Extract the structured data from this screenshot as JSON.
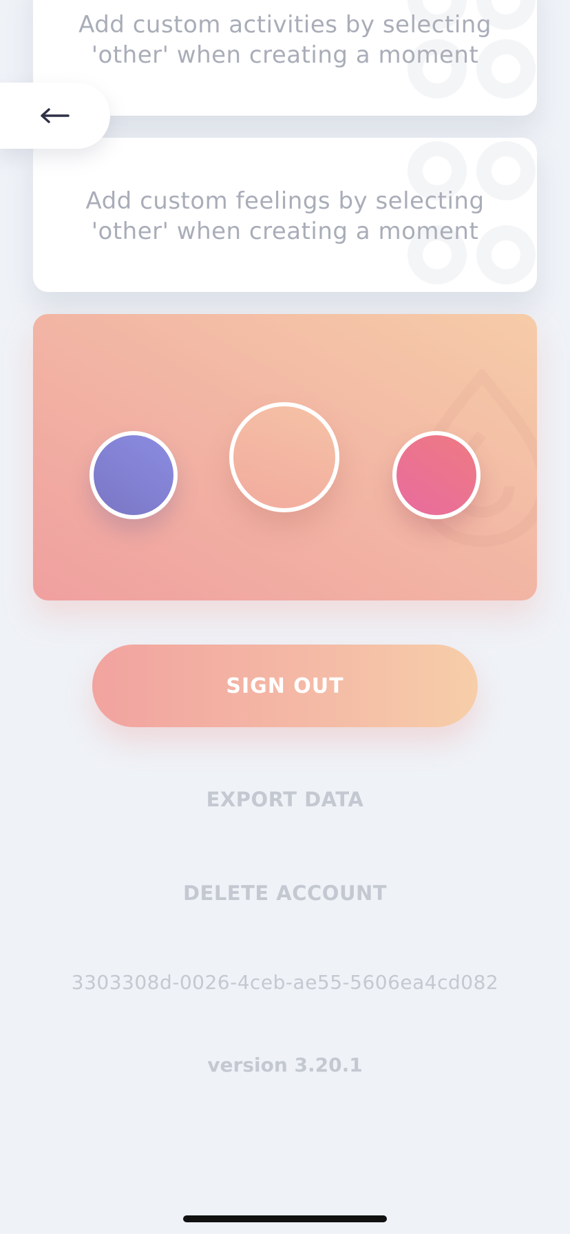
{
  "cards": {
    "activities": {
      "line1": "Add custom activities by selecting",
      "line2": "'other' when creating a moment"
    },
    "feelings": {
      "line1": "Add custom feelings by selecting",
      "line2": "'other' when creating a moment"
    }
  },
  "navigation": {
    "back_icon": "arrow-left-icon"
  },
  "theme_picker": {
    "swatches": [
      {
        "name": "blue",
        "color": "#8583D6"
      },
      {
        "name": "peach",
        "color": "#F4B9A3"
      },
      {
        "name": "pink",
        "color": "#EA7391"
      }
    ],
    "selected": "peach"
  },
  "actions": {
    "sign_out_label": "SIGN OUT",
    "export_label": "EXPORT DATA",
    "delete_label": "DELETE ACCOUNT"
  },
  "footer": {
    "user_id": "3303308d-0026-4ceb-ae55-5606ea4cd082",
    "version": "version 3.20.1"
  },
  "colors": {
    "background": "#EFF2F7",
    "muted_text": "#C4C8D1",
    "accent_start": "#F2A39F",
    "accent_end": "#F7CEA9"
  }
}
